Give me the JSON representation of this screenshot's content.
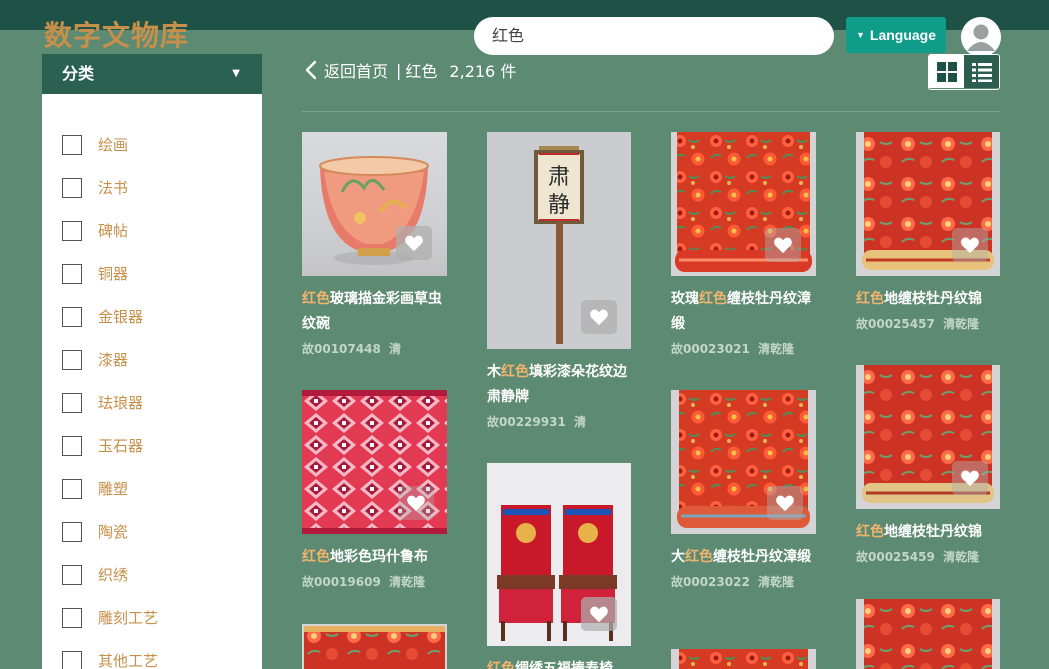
{
  "header": {
    "logo": "数字文物库",
    "search": {
      "value": "红色"
    },
    "language_label": "Language"
  },
  "sidebar": {
    "title": "分类",
    "items": [
      {
        "label": "绘画"
      },
      {
        "label": "法书"
      },
      {
        "label": "碑帖"
      },
      {
        "label": "铜器"
      },
      {
        "label": "金银器"
      },
      {
        "label": "漆器"
      },
      {
        "label": "珐琅器"
      },
      {
        "label": "玉石器"
      },
      {
        "label": "雕塑"
      },
      {
        "label": "陶瓷"
      },
      {
        "label": "织绣"
      },
      {
        "label": "雕刻工艺"
      },
      {
        "label": "其他工艺"
      }
    ]
  },
  "breadcrumb": {
    "back_label": "返回首页",
    "separator": "|",
    "query": "红色",
    "count": "2,216 件"
  },
  "results": [
    {
      "title_pre": "",
      "title_hl": "红色",
      "title_post": "玻璃描金彩画草虫纹碗",
      "id": "故00107448",
      "period": "清"
    },
    {
      "title_pre": "木",
      "title_hl": "红色",
      "title_post": "填彩漆朵花纹边肃静牌",
      "id": "故00229931",
      "period": "清"
    },
    {
      "title_pre": "玫瑰",
      "title_hl": "红色",
      "title_post": "缠枝牡丹纹漳缎",
      "id": "故00023021",
      "period": "清乾隆"
    },
    {
      "title_pre": "",
      "title_hl": "红色",
      "title_post": "地缠枝牡丹纹锦",
      "id": "故00025457",
      "period": "清乾隆"
    },
    {
      "title_pre": "",
      "title_hl": "红色",
      "title_post": "地彩色玛什鲁布",
      "id": "故00019609",
      "period": "清乾隆"
    },
    {
      "title_pre": "",
      "title_hl": "红色",
      "title_post": "绸绣五福捧寿椅",
      "id": "",
      "period": ""
    },
    {
      "title_pre": "大",
      "title_hl": "红色",
      "title_post": "缠枝牡丹纹漳缎",
      "id": "故00023022",
      "period": "清乾隆"
    },
    {
      "title_pre": "",
      "title_hl": "红色",
      "title_post": "地缠枝牡丹纹锦",
      "id": "故00025459",
      "period": "清乾隆"
    }
  ]
}
